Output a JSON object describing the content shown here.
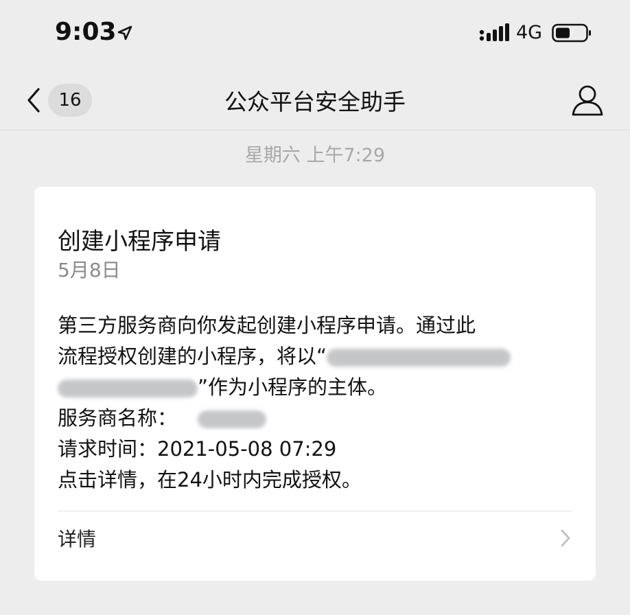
{
  "status_bar": {
    "time": "9:03",
    "network": "4G"
  },
  "nav": {
    "unread_count": "16",
    "title": "公众平台安全助手"
  },
  "timestamp": "星期六 上午7:29",
  "message": {
    "title": "创建小程序申请",
    "date": "5月8日",
    "line1": "第三方服务商向你发起创建小程序申请。通过此",
    "line2": "流程授权创建的小程序，将以“",
    "line3_suffix": "”作为小程序的主体。",
    "provider_label": "服务商名称：",
    "request_time": "请求时间：2021-05-08 07:29",
    "instruction": "点击详情，在24小时内完成授权。",
    "details_label": "详情"
  }
}
